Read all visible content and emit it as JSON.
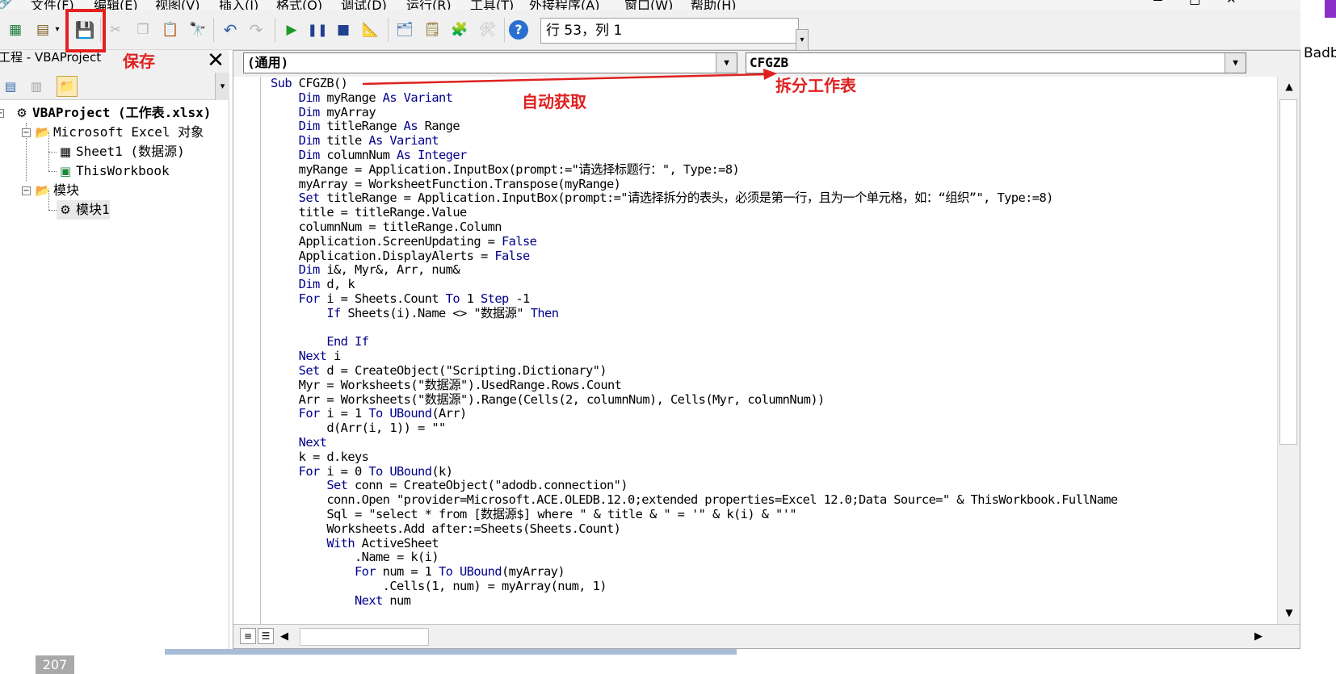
{
  "menubar": {
    "items": [
      "文件(F)",
      "编辑(E)",
      "视图(V)",
      "插入(I)",
      "格式(O)",
      "调试(D)",
      "运行(R)",
      "工具(T)",
      "外接程序(A)",
      "窗口(W)",
      "帮助(H)"
    ],
    "window_controls": [
      "－",
      "□",
      "✕"
    ]
  },
  "toolbar": {
    "status": "行 53，列 1"
  },
  "project_pane": {
    "title": "工程 - VBAProject",
    "close": "✕",
    "tree": {
      "root": "VBAProject (工作表.xlsx)",
      "excel_objects": "Microsoft Excel 对象",
      "sheet1": "Sheet1 (数据源)",
      "thisworkbook": "ThisWorkbook",
      "modules": "模块",
      "module1": "模块1"
    }
  },
  "code_window": {
    "object_combo": "(通用)",
    "procedure_combo": "CFGZB",
    "lines": [
      [
        [
          "kw",
          "Sub"
        ],
        [
          "t",
          " CFGZB()"
        ]
      ],
      [
        [
          "t",
          "    "
        ],
        [
          "kw",
          "Dim"
        ],
        [
          "t",
          " myRange "
        ],
        [
          "kw",
          "As Variant"
        ]
      ],
      [
        [
          "t",
          "    "
        ],
        [
          "kw",
          "Dim"
        ],
        [
          "t",
          " myArray"
        ]
      ],
      [
        [
          "t",
          "    "
        ],
        [
          "kw",
          "Dim"
        ],
        [
          "t",
          " titleRange "
        ],
        [
          "kw",
          "As"
        ],
        [
          "t",
          " Range"
        ]
      ],
      [
        [
          "t",
          "    "
        ],
        [
          "kw",
          "Dim"
        ],
        [
          "t",
          " title "
        ],
        [
          "kw",
          "As Variant"
        ]
      ],
      [
        [
          "t",
          "    "
        ],
        [
          "kw",
          "Dim"
        ],
        [
          "t",
          " columnNum "
        ],
        [
          "kw",
          "As Integer"
        ]
      ],
      [
        [
          "t",
          "    myRange = Application.InputBox(prompt:=\"请选择标题行：\", Type:=8)"
        ]
      ],
      [
        [
          "t",
          "    myArray = WorksheetFunction.Transpose(myRange)"
        ]
      ],
      [
        [
          "t",
          "    "
        ],
        [
          "kw",
          "Set"
        ],
        [
          "t",
          " titleRange = Application.InputBox(prompt:=\"请选择拆分的表头，必须是第一行，且为一个单元格，如：“组织”\", Type:=8)"
        ]
      ],
      [
        [
          "t",
          "    title = titleRange.Value"
        ]
      ],
      [
        [
          "t",
          "    columnNum = titleRange.Column"
        ]
      ],
      [
        [
          "t",
          "    Application.ScreenUpdating = "
        ],
        [
          "kw",
          "False"
        ]
      ],
      [
        [
          "t",
          "    Application.DisplayAlerts = "
        ],
        [
          "kw",
          "False"
        ]
      ],
      [
        [
          "t",
          "    "
        ],
        [
          "kw",
          "Dim"
        ],
        [
          "t",
          " i&, Myr&, Arr, num&"
        ]
      ],
      [
        [
          "t",
          "    "
        ],
        [
          "kw",
          "Dim"
        ],
        [
          "t",
          " d, k"
        ]
      ],
      [
        [
          "t",
          "    "
        ],
        [
          "kw",
          "For"
        ],
        [
          "t",
          " i = Sheets.Count "
        ],
        [
          "kw",
          "To"
        ],
        [
          "t",
          " 1 "
        ],
        [
          "kw",
          "Step"
        ],
        [
          "t",
          " -1"
        ]
      ],
      [
        [
          "t",
          "        "
        ],
        [
          "kw",
          "If"
        ],
        [
          "t",
          " Sheets(i).Name <> \"数据源\" "
        ],
        [
          "kw",
          "Then"
        ]
      ],
      [
        [
          "t",
          ""
        ]
      ],
      [
        [
          "t",
          "        "
        ],
        [
          "kw",
          "End If"
        ]
      ],
      [
        [
          "t",
          "    "
        ],
        [
          "kw",
          "Next"
        ],
        [
          "t",
          " i"
        ]
      ],
      [
        [
          "t",
          "    "
        ],
        [
          "kw",
          "Set"
        ],
        [
          "t",
          " d = CreateObject(\"Scripting.Dictionary\")"
        ]
      ],
      [
        [
          "t",
          "    Myr = Worksheets(\"数据源\").UsedRange.Rows.Count"
        ]
      ],
      [
        [
          "t",
          "    Arr = Worksheets(\"数据源\").Range(Cells(2, columnNum), Cells(Myr, columnNum))"
        ]
      ],
      [
        [
          "t",
          "    "
        ],
        [
          "kw",
          "For"
        ],
        [
          "t",
          " i = 1 "
        ],
        [
          "kw",
          "To"
        ],
        [
          "t",
          " "
        ],
        [
          "kw",
          "UBound"
        ],
        [
          "t",
          "(Arr)"
        ]
      ],
      [
        [
          "t",
          "        d(Arr(i, 1)) = \"\""
        ]
      ],
      [
        [
          "t",
          "    "
        ],
        [
          "kw",
          "Next"
        ]
      ],
      [
        [
          "t",
          "    k = d.keys"
        ]
      ],
      [
        [
          "t",
          "    "
        ],
        [
          "kw",
          "For"
        ],
        [
          "t",
          " i = 0 "
        ],
        [
          "kw",
          "To"
        ],
        [
          "t",
          " "
        ],
        [
          "kw",
          "UBound"
        ],
        [
          "t",
          "(k)"
        ]
      ],
      [
        [
          "t",
          "        "
        ],
        [
          "kw",
          "Set"
        ],
        [
          "t",
          " conn = CreateObject(\"adodb.connection\")"
        ]
      ],
      [
        [
          "t",
          "        conn.Open \"provider=Microsoft.ACE.OLEDB.12.0;extended properties=Excel 12.0;Data Source=\" & ThisWorkbook.FullName"
        ]
      ],
      [
        [
          "t",
          "        Sql = \"select * from [数据源$] where \" & title & \" = '\" & k(i) & \"'\""
        ]
      ],
      [
        [
          "t",
          "        Worksheets.Add after:=Sheets(Sheets.Count)"
        ]
      ],
      [
        [
          "t",
          "        "
        ],
        [
          "kw",
          "With"
        ],
        [
          "t",
          " ActiveSheet"
        ]
      ],
      [
        [
          "t",
          "            .Name = k(i)"
        ]
      ],
      [
        [
          "t",
          "            "
        ],
        [
          "kw",
          "For"
        ],
        [
          "t",
          " num = 1 "
        ],
        [
          "kw",
          "To"
        ],
        [
          "t",
          " "
        ],
        [
          "kw",
          "UBound"
        ],
        [
          "t",
          "(myArray)"
        ]
      ],
      [
        [
          "t",
          "                .Cells(1, num) = myArray(num, 1)"
        ]
      ],
      [
        [
          "t",
          "            "
        ],
        [
          "kw",
          "Next"
        ],
        [
          "t",
          " num"
        ]
      ]
    ]
  },
  "annotations": {
    "save": "保存",
    "auto": "自动获取",
    "split": "拆分工作表"
  },
  "background": {
    "right_fragment": "Badb",
    "bottom_number": "207"
  },
  "colors": {
    "keyword": "#00008b",
    "annotation_red": "#e02020"
  }
}
